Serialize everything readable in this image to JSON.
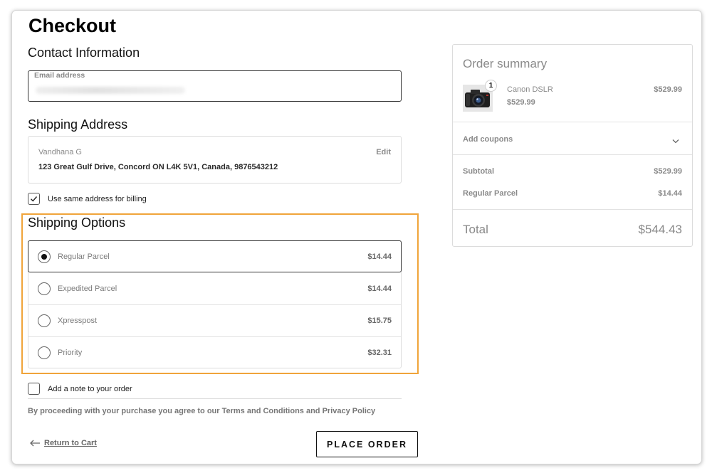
{
  "page": {
    "title": "Checkout"
  },
  "contact": {
    "title": "Contact Information",
    "email_label": "Email address"
  },
  "shipping_address": {
    "title": "Shipping Address",
    "name": "Vandhana G",
    "edit_label": "Edit",
    "address_line": "123 Great Gulf Drive, Concord ON L4K 5V1, Canada, 9876543212"
  },
  "billing": {
    "same_address_label": "Use same address for billing",
    "checked": true
  },
  "shipping_options": {
    "title": "Shipping Options",
    "options": [
      {
        "name": "Regular Parcel",
        "price": "$14.44",
        "selected": true
      },
      {
        "name": "Expedited Parcel",
        "price": "$14.44",
        "selected": false
      },
      {
        "name": "Xpresspost",
        "price": "$15.75",
        "selected": false
      },
      {
        "name": "Priority",
        "price": "$32.31",
        "selected": false
      }
    ]
  },
  "note": {
    "label": "Add a note to your order",
    "checked": false
  },
  "terms_text": "By proceeding with your purchase you agree to our Terms and Conditions and Privacy Policy",
  "actions": {
    "return_label": "Return to Cart",
    "place_order_label": "PLACE ORDER"
  },
  "summary": {
    "title": "Order summary",
    "item": {
      "name": "Canon DSLR",
      "quantity": "1",
      "unit_price": "$529.99",
      "line_total": "$529.99"
    },
    "coupons_label": "Add coupons",
    "subtotal_label": "Subtotal",
    "subtotal_value": "$529.99",
    "shipping_label": "Regular Parcel",
    "shipping_value": "$14.44",
    "total_label": "Total",
    "total_value": "$544.43"
  },
  "colors": {
    "highlight": "#f0a43a",
    "text_muted": "#8a8a8a",
    "border": "#dcdcdc"
  },
  "icons": [
    "checkmark-icon",
    "chevron-down-icon",
    "arrow-left-icon",
    "camera-product-image"
  ]
}
